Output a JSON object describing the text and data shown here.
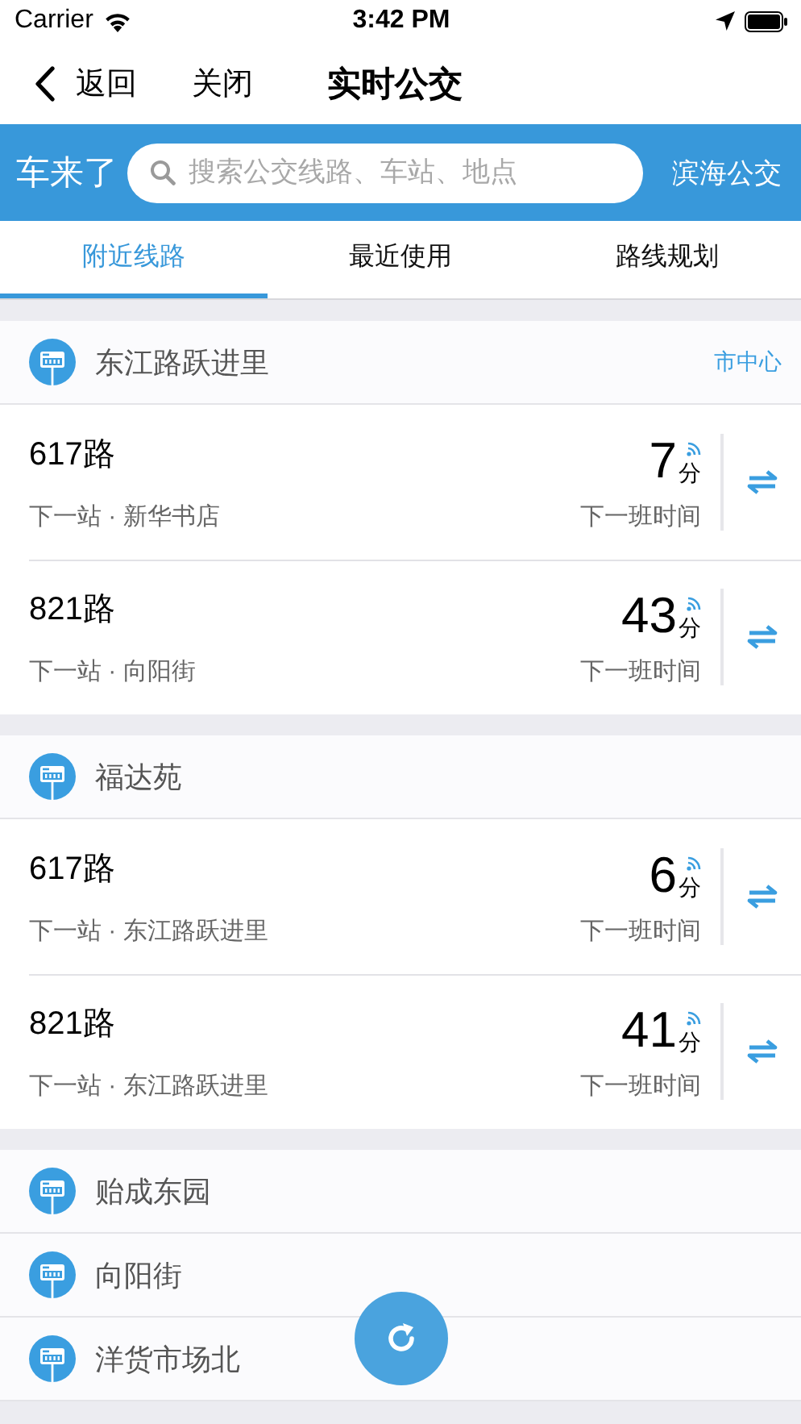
{
  "status_bar": {
    "carrier": "Carrier",
    "time": "3:42 PM"
  },
  "nav": {
    "back": "返回",
    "close": "关闭",
    "title": "实时公交"
  },
  "header": {
    "logo": "车来了",
    "search": {
      "placeholder": "搜索公交线路、车站、地点"
    },
    "city": "滨海公交"
  },
  "tabs": [
    {
      "label": "附近线路",
      "selected": true
    },
    {
      "label": "最近使用",
      "selected": false
    },
    {
      "label": "路线规划",
      "selected": false
    }
  ],
  "stations": [
    {
      "name": "东江路跃进里",
      "district": "市中心",
      "routes": [
        {
          "line": "617路",
          "next_stop": "下一站 · 新华书店",
          "minutes": "7",
          "unit": "分",
          "caption": "下一班时间"
        },
        {
          "line": "821路",
          "next_stop": "下一站 · 向阳街",
          "minutes": "43",
          "unit": "分",
          "caption": "下一班时间"
        }
      ]
    },
    {
      "name": "福达苑",
      "routes": [
        {
          "line": "617路",
          "next_stop": "下一站 · 东江路跃进里",
          "minutes": "6",
          "unit": "分",
          "caption": "下一班时间"
        },
        {
          "line": "821路",
          "next_stop": "下一站 · 东江路跃进里",
          "minutes": "41",
          "unit": "分",
          "caption": "下一班时间"
        }
      ]
    },
    {
      "name": "贻成东园"
    },
    {
      "name": "向阳街"
    },
    {
      "name": "洋货市场北"
    }
  ]
}
